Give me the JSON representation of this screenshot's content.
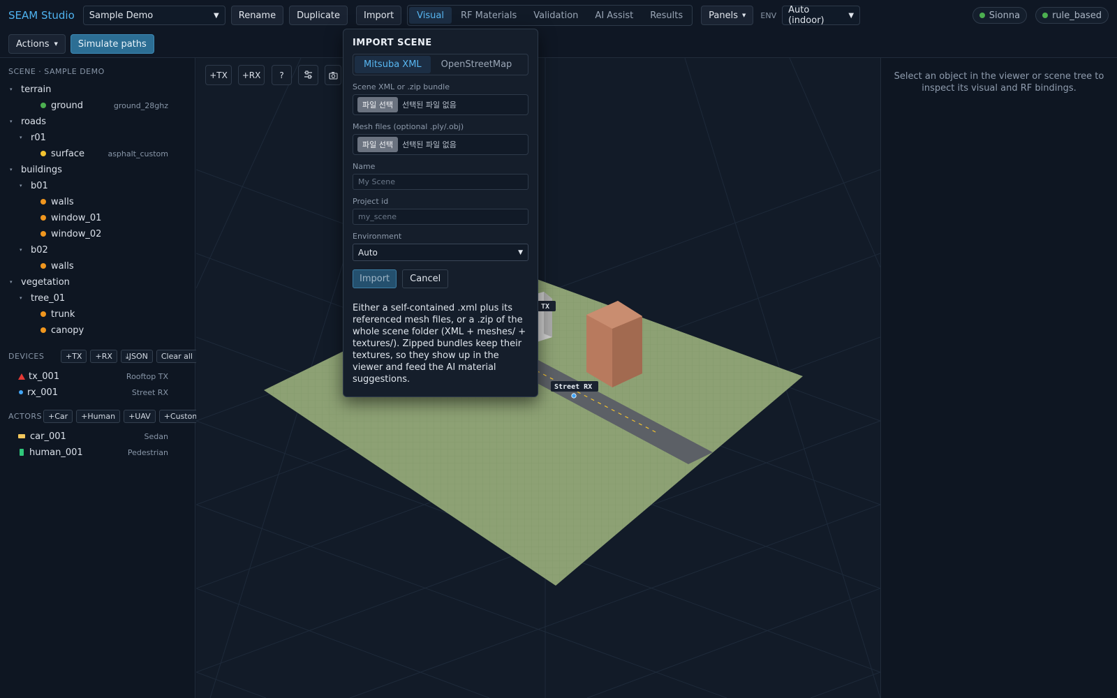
{
  "app": {
    "brand": "SEAM Studio"
  },
  "header": {
    "scene_select": "Sample Demo",
    "rename": "Rename",
    "duplicate": "Duplicate",
    "import": "Import",
    "tabs": [
      "Visual",
      "RF Materials",
      "Validation",
      "AI Assist",
      "Results"
    ],
    "active_tab": "Visual",
    "panels": "Panels",
    "env_label": "ENV",
    "env_select": "Auto (indoor)",
    "status_pills": [
      {
        "label": "Sionna",
        "color": "#4caf50"
      },
      {
        "label": "rule_based",
        "color": "#4caf50"
      }
    ]
  },
  "toolbar2": {
    "actions": "Actions",
    "simulate": "Simulate paths"
  },
  "scene_tree": {
    "title": "SCENE · SAMPLE DEMO",
    "nodes": [
      {
        "label": "terrain",
        "level": 0,
        "caret": true
      },
      {
        "label": "ground",
        "level": 2,
        "dot": "#4caf50",
        "tag": "ground_28ghz"
      },
      {
        "label": "roads",
        "level": 0,
        "caret": true
      },
      {
        "label": "r01",
        "level": 1,
        "caret": true
      },
      {
        "label": "surface",
        "level": 2,
        "dot": "#f2c230",
        "tag": "asphalt_custom"
      },
      {
        "label": "buildings",
        "level": 0,
        "caret": true
      },
      {
        "label": "b01",
        "level": 1,
        "caret": true
      },
      {
        "label": "walls",
        "level": 2,
        "dot": "#f0961e"
      },
      {
        "label": "window_01",
        "level": 2,
        "dot": "#f0961e"
      },
      {
        "label": "window_02",
        "level": 2,
        "dot": "#f0961e"
      },
      {
        "label": "b02",
        "level": 1,
        "caret": true
      },
      {
        "label": "walls",
        "level": 2,
        "dot": "#f0961e"
      },
      {
        "label": "vegetation",
        "level": 0,
        "caret": true
      },
      {
        "label": "tree_01",
        "level": 1,
        "caret": true
      },
      {
        "label": "trunk",
        "level": 2,
        "dot": "#f0961e"
      },
      {
        "label": "canopy",
        "level": 2,
        "dot": "#f0961e"
      }
    ]
  },
  "devices": {
    "title": "DEVICES",
    "buttons": [
      "+TX",
      "+RX",
      "⤓JSON",
      "Clear all"
    ],
    "items": [
      {
        "label": "tx_001",
        "tag": "Rooftop TX",
        "icon": "triangle-icon",
        "color": "#e53935"
      },
      {
        "label": "rx_001",
        "tag": "Street RX",
        "icon": "circle-icon",
        "color": "#42a5f5"
      }
    ]
  },
  "actors": {
    "title": "ACTORS",
    "buttons": [
      "+Car",
      "+Human",
      "+UAV",
      "+Custom"
    ],
    "items": [
      {
        "label": "car_001",
        "tag": "Sedan",
        "icon": "car-icon",
        "color": "#f2c75c"
      },
      {
        "label": "human_001",
        "tag": "Pedestrian",
        "icon": "human-icon",
        "color": "#2fc77a"
      }
    ]
  },
  "viewer": {
    "tools": [
      "+TX",
      "+RX",
      "?",
      "sliders-icon",
      "camera-icon"
    ],
    "labels": {
      "tx": "TX",
      "rx": "Street RX"
    }
  },
  "inspector": {
    "message": "Select an object in the viewer or scene tree to inspect its visual and RF bindings."
  },
  "import_modal": {
    "title": "IMPORT SCENE",
    "tabs": [
      "Mitsuba XML",
      "OpenStreetMap"
    ],
    "active_tab": "Mitsuba XML",
    "xml_label": "Scene XML or .zip bundle",
    "mesh_label": "Mesh files (optional .ply/.obj)",
    "file_button": "파일 선택",
    "file_none": "선택된 파일 없음",
    "name_label": "Name",
    "name_placeholder": "My Scene",
    "project_label": "Project id",
    "project_placeholder": "my_scene",
    "env_label": "Environment",
    "env_value": "Auto",
    "import_btn": "Import",
    "cancel_btn": "Cancel",
    "description": "Either a self-contained .xml plus its referenced mesh files, or a .zip of the whole scene folder (XML + meshes/ + textures/). Zipped bundles keep their textures, so they show up in the viewer and feed the AI material suggestions."
  }
}
